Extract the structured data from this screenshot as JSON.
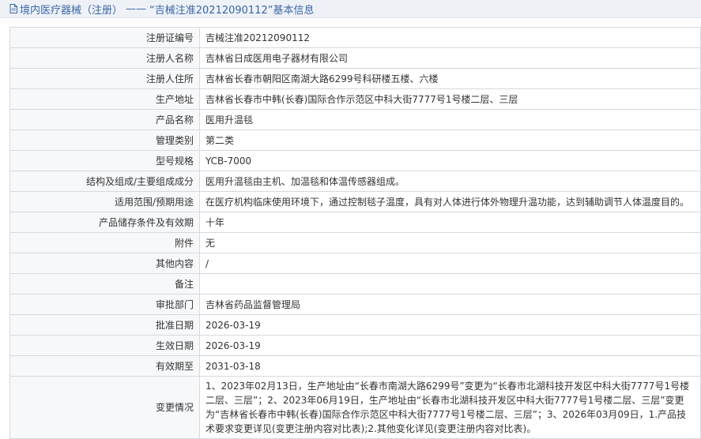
{
  "title": {
    "section": "境内医疗器械（注册）",
    "dash": "——",
    "record": "“吉械注准20212090112”",
    "suffix": "基本信息"
  },
  "rows": [
    {
      "label": "注册证编号",
      "value": "吉械注准20212090112"
    },
    {
      "label": "注册人名称",
      "value": "吉林省日成医用电子器材有限公司"
    },
    {
      "label": "注册人住所",
      "value": "吉林省长春市朝阳区南湖大路6299号科研楼五楼、六楼"
    },
    {
      "label": "生产地址",
      "value": "吉林省长春市中韩(长春)国际合作示范区中科大街7777号1号楼二层、三层"
    },
    {
      "label": "产品名称",
      "value": "医用升温毯"
    },
    {
      "label": "管理类别",
      "value": "第二类"
    },
    {
      "label": "型号规格",
      "value": "YCB-7000"
    },
    {
      "label": "结构及组成/主要组成成分",
      "value": "医用升温毯由主机、加温毯和体温传感器组成。"
    },
    {
      "label": "适用范围/预期用途",
      "value": "在医疗机构临床使用环境下，通过控制毯子温度，具有对人体进行体外物理升温功能，达到辅助调节人体温度目的。"
    },
    {
      "label": "产品储存条件及有效期",
      "value": "十年"
    },
    {
      "label": "附件",
      "value": "无"
    },
    {
      "label": "其他内容",
      "value": "/"
    },
    {
      "label": "备注",
      "value": ""
    },
    {
      "label": "审批部门",
      "value": "吉林省药品监督管理局"
    },
    {
      "label": "批准日期",
      "value": "2026-03-19"
    },
    {
      "label": "生效日期",
      "value": "2026-03-19"
    },
    {
      "label": "有效期至",
      "value": "2031-03-18"
    },
    {
      "label": "变更情况",
      "value": "1、2023年02月13日，生产地址由“长春市南湖大路6299号”变更为“长春市北湖科技开发区中科大街7777号1号楼二层、三层”；2、2023年06月19日，生产地址由“长春市北湖科技开发区中科大街7777号1号楼二层、三层”变更为“吉林省长春市中韩(长春)国际合作示范区中科大街7777号1号楼二层、三层”；3、2026年03月09日，1.产品技术要求变更详见(变更注册内容对比表);2.其他变化详见(变更注册内容对比表)。"
    }
  ]
}
